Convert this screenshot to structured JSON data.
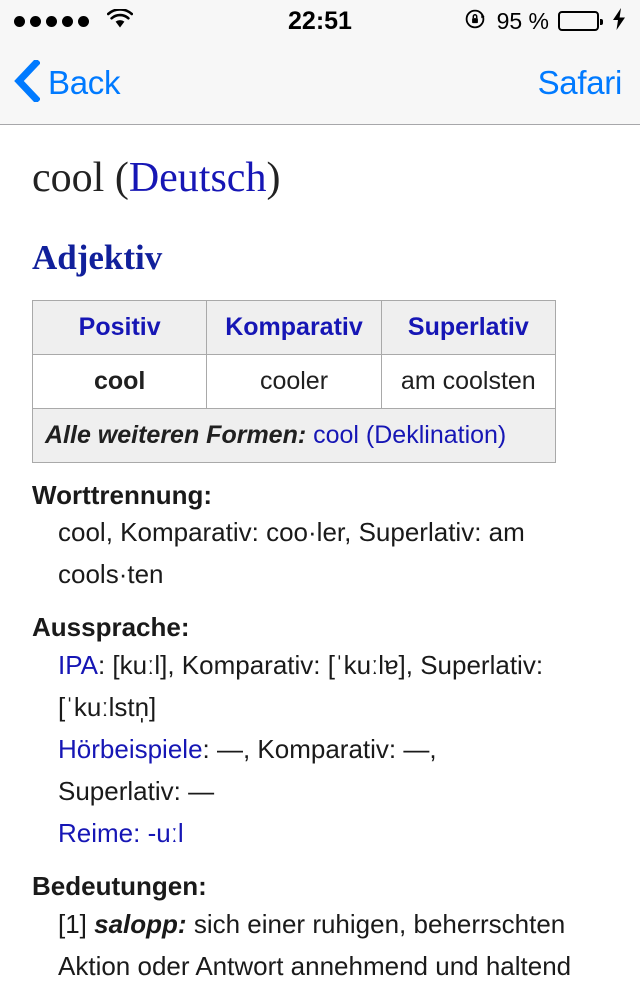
{
  "status_bar": {
    "signal_dots": 5,
    "signal_dots_filled": 5,
    "wifi_icon": "wifi-icon",
    "time": "22:51",
    "rotation_lock_icon": "rotation-lock-icon",
    "battery_percent": "95 %",
    "battery_level": 95,
    "battery_color": "#4cd964",
    "charging_icon": "lightning-bolt-icon"
  },
  "nav_bar": {
    "back_icon": "chevron-left-icon",
    "back_label": "Back",
    "right_label": "Safari",
    "tint_color": "#007aff"
  },
  "page": {
    "title_word": "cool",
    "title_open_paren": " (",
    "title_language_link": "Deutsch",
    "title_close_paren": ")",
    "pos_heading": "Adjektiv",
    "link_color": "#1616b5"
  },
  "inflection_table": {
    "headers": [
      "Positiv",
      "Komparativ",
      "Superlativ"
    ],
    "row": [
      "cool",
      "cooler",
      "am coolsten"
    ],
    "footer_label": "Alle weiteren Formen:",
    "footer_link": " cool (Deklination)"
  },
  "sections": [
    {
      "label": "Worttrennung:",
      "lines": [
        {
          "text": "cool, Komparativ: coo·ler, Superlativ: am"
        },
        {
          "text": "cools·ten"
        }
      ]
    },
    {
      "label": "Aussprache:",
      "lines": [
        {
          "link": "IPA",
          "text": ": [kuːl], Komparativ: [ˈkuːlɐ], Superlativ:"
        },
        {
          "text": "[ˈkuːlstn̩]"
        },
        {
          "link": "Hörbeispiele",
          "text": ": —, Komparativ: —,"
        },
        {
          "text": "Superlativ: —"
        },
        {
          "link": "Reime:",
          "link2": " -uːl"
        }
      ]
    },
    {
      "label": "Bedeutungen:",
      "lines": [
        {
          "num": "[1] ",
          "italic": "salopp:",
          "text": " sich einer ruhigen, beherrschten"
        },
        {
          "text": "Aktion oder Antwort annehmend und haltend"
        }
      ]
    }
  ]
}
